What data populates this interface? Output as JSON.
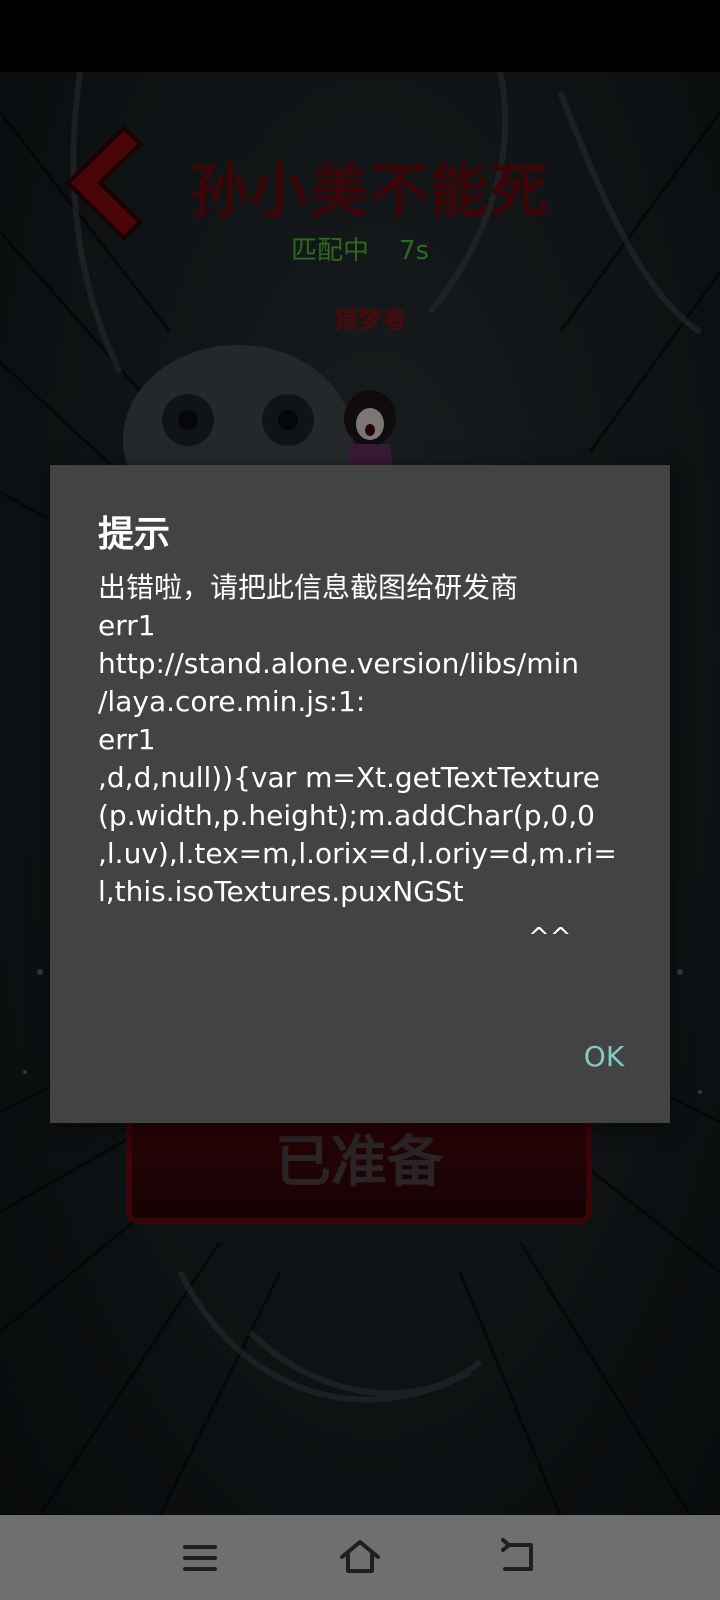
{
  "game": {
    "title": "孙小美不能死",
    "match_status": "匹配中",
    "match_timer": "7s",
    "role": "猎梦者",
    "ready_button": "已准备"
  },
  "dialog": {
    "title": "提示",
    "message_lines": [
      "出错啦，请把此信息截图给研发商",
      "err1",
      "http://stand.alone.version/libs/min",
      "/laya.core.min.js:1:",
      "err1",
      ",d,d,null)){var m=Xt.getTextTexture",
      "(p.width,p.height);m.addChar(p,0,0",
      ",l.uv),l.tex=m,l.orix=d,l.oriy=d,m.ri=",
      "l,this.isoTextures.puxNGSt"
    ],
    "caret": "^^",
    "ok_label": "OK"
  },
  "nav_bar": {
    "icons": [
      "menu-icon",
      "home-icon",
      "back-icon"
    ]
  },
  "colors": {
    "dialog_bg": "#434343",
    "ok_accent": "#80cbc4",
    "nav_bg": "#6f6f6f",
    "title_red": "#3a0608",
    "status_green": "#2d6a1a"
  }
}
